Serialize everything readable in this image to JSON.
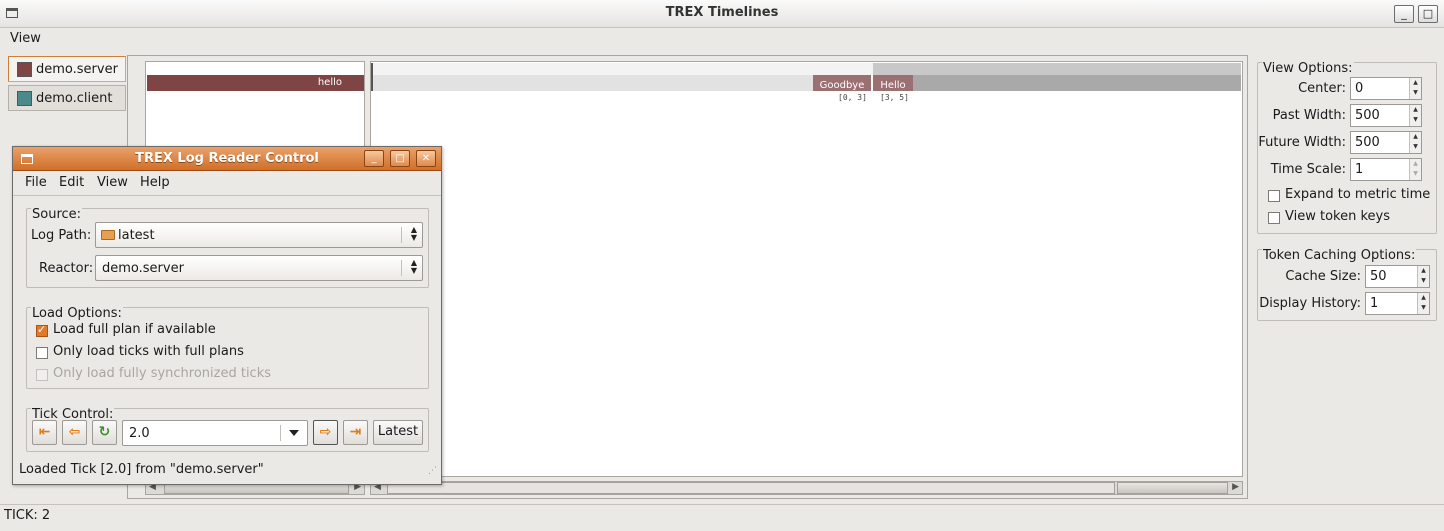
{
  "app": {
    "title": "TREX Timelines"
  },
  "menubar": {
    "view": "View"
  },
  "reactors": [
    {
      "name": "demo.server",
      "color": "#7f4545",
      "active": true
    },
    {
      "name": "demo.client",
      "color": "#4a8a8a",
      "active": false
    }
  ],
  "timeline": {
    "lane_token": "hello",
    "tokens": [
      {
        "label": "Goodbye",
        "range": "[0, 3]"
      },
      {
        "label": "Hello",
        "range": "[3, 5]"
      }
    ]
  },
  "view_options": {
    "title": "View Options:",
    "center": {
      "label": "Center:",
      "value": "0"
    },
    "past_width": {
      "label": "Past Width:",
      "value": "500"
    },
    "future_width": {
      "label": "Future Width:",
      "value": "500"
    },
    "time_scale": {
      "label": "Time Scale:",
      "value": "1"
    },
    "expand_metric": {
      "label": "Expand to metric time",
      "checked": false
    },
    "view_token_keys": {
      "label": "View token keys",
      "checked": false
    }
  },
  "token_caching": {
    "title": "Token Caching Options:",
    "cache_size": {
      "label": "Cache Size:",
      "value": "50"
    },
    "display_history": {
      "label": "Display History:",
      "value": "1"
    }
  },
  "status": {
    "tick": "TICK: 2"
  },
  "dialog": {
    "title": "TREX Log Reader Control",
    "menu": {
      "file": "File",
      "edit": "Edit",
      "view": "View",
      "help": "Help"
    },
    "source": {
      "title": "Source:",
      "log_path_label": "Log Path:",
      "log_path_value": "latest",
      "reactor_label": "Reactor:",
      "reactor_value": "demo.server"
    },
    "load_options": {
      "title": "Load Options:",
      "full_plan": "Load full plan if available",
      "ticks_full_plans": "Only load ticks with full plans",
      "sync_ticks": "Only load fully synchronized ticks"
    },
    "tick_control": {
      "title": "Tick Control:",
      "tick_value": "2.0",
      "latest_label": "Latest"
    },
    "status": "Loaded Tick [2.0] from \"demo.server\""
  }
}
